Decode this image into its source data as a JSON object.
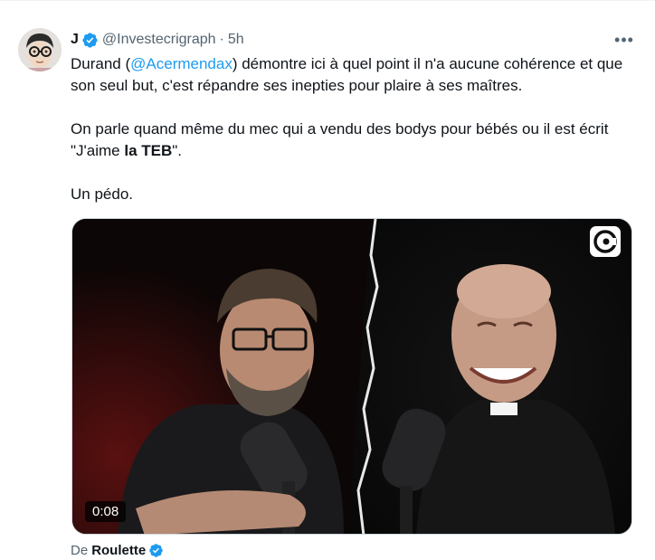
{
  "author": {
    "display_name": "J",
    "handle": "@Investecrigraph",
    "separator": "·",
    "time": "5h"
  },
  "more_label": "•••",
  "tweet": {
    "line1_prefix": "Durand (",
    "mention": "@Acermendax",
    "line1_suffix": ") démontre ici à quel point il n'a aucune cohérence et que son seul but, c'est répandre ses inepties pour plaire à ses maîtres.",
    "para2_prefix": "On parle quand même du mec qui a vendu des bodys pour bébés ou il est écrit \"J'aime ",
    "para2_bold": "la TEB",
    "para2_suffix": "\".",
    "para3": "Un pédo."
  },
  "video": {
    "duration": "0:08"
  },
  "attribution": {
    "prefix": "De",
    "name": "Roulette"
  },
  "colors": {
    "accent": "#1d9bf0",
    "secondary_text": "#536471",
    "primary_text": "#0f1419"
  }
}
